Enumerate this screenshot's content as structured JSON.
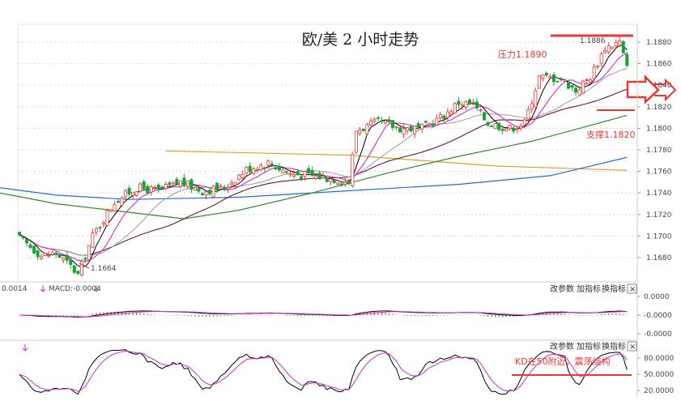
{
  "title": "欧/美 2 小时走势",
  "annotations": {
    "resistance_label": "压力1.1890",
    "support_label": "支撑1.1820",
    "high_label": "1.1886",
    "low_label": "1.1664",
    "kd_note": "KD在50附近，震荡结构"
  },
  "macd_panel": {
    "header_value": "0.0014",
    "header_macd": "MACD:-0.0004"
  },
  "panel_buttons": [
    "改参数",
    "加指标",
    "换指标",
    "×"
  ],
  "colors": {
    "up": "#e8382f",
    "down": "#15a336",
    "ma5": "#000000",
    "ma10": "#d02bd0",
    "ma20": "#9a9a9a",
    "ma60": "#6b1b2b",
    "ma120": "#2e8b2e",
    "ma200": "#1e6fd0",
    "ma_long": "#d9a22a",
    "annotation": "#e8382f"
  },
  "chart_data": [
    {
      "type": "candlestick",
      "title": "欧/美 2 小时走势",
      "y_ticks": [
        "1.1880",
        "1.1860",
        "1.1840",
        "1.1820",
        "1.1800",
        "1.1780",
        "1.1760",
        "1.1740",
        "1.1720",
        "1.1700",
        "1.1680"
      ],
      "y_range": [
        1.166,
        1.1895
      ],
      "resistance": 1.189,
      "support": 1.182,
      "period_high": 1.1886,
      "period_low": 1.1664,
      "anchors": [
        [
          0,
          1.1698
        ],
        [
          6,
          1.1682
        ],
        [
          10,
          1.1684
        ],
        [
          14,
          1.1672
        ],
        [
          16,
          1.1664
        ],
        [
          20,
          1.17
        ],
        [
          26,
          1.1732
        ],
        [
          32,
          1.1745
        ],
        [
          38,
          1.1742
        ],
        [
          44,
          1.175
        ],
        [
          50,
          1.1742
        ],
        [
          56,
          1.1745
        ],
        [
          62,
          1.1762
        ],
        [
          68,
          1.1768
        ],
        [
          74,
          1.1758
        ],
        [
          80,
          1.1756
        ],
        [
          88,
          1.1752
        ],
        [
          90,
          1.175
        ],
        [
          92,
          1.1798
        ],
        [
          98,
          1.1806
        ],
        [
          104,
          1.18
        ],
        [
          110,
          1.18
        ],
        [
          116,
          1.1812
        ],
        [
          120,
          1.1824
        ],
        [
          124,
          1.1822
        ],
        [
          128,
          1.1805
        ],
        [
          134,
          1.18
        ],
        [
          138,
          1.1805
        ],
        [
          142,
          1.1848
        ],
        [
          148,
          1.1846
        ],
        [
          152,
          1.1835
        ],
        [
          156,
          1.1848
        ],
        [
          160,
          1.1875
        ],
        [
          164,
          1.188
        ],
        [
          166,
          1.1856
        ]
      ],
      "ma_lines": [
        {
          "key": "ma_long",
          "points": [
            [
              40,
              1.1779
            ],
            [
              90,
              1.1775
            ],
            [
              130,
              1.1765
            ],
            [
              166,
              1.1761
            ]
          ]
        },
        {
          "key": "ma200",
          "points": [
            [
              -10,
              1.1747
            ],
            [
              10,
              1.1738
            ],
            [
              30,
              1.1734
            ],
            [
              60,
              1.1736
            ],
            [
              90,
              1.1742
            ],
            [
              120,
              1.1748
            ],
            [
              145,
              1.1756
            ],
            [
              166,
              1.1773
            ]
          ]
        },
        {
          "key": "ma120",
          "points": [
            [
              -10,
              1.1743
            ],
            [
              10,
              1.173
            ],
            [
              30,
              1.1722
            ],
            [
              45,
              1.1716
            ],
            [
              60,
              1.1724
            ],
            [
              80,
              1.174
            ],
            [
              100,
              1.1758
            ],
            [
              120,
              1.1774
            ],
            [
              140,
              1.1788
            ],
            [
              166,
              1.1812
            ]
          ]
        }
      ]
    },
    {
      "type": "macd",
      "y_ticks": [
        "0.0000",
        "-0.0000",
        "-0.0000"
      ],
      "y_range": [
        -0.003,
        0.003
      ]
    },
    {
      "type": "kd",
      "y_ticks": [
        "80.0000",
        "50.0000",
        "20.0000"
      ],
      "y_range": [
        0,
        100
      ],
      "reference_level": 50
    }
  ]
}
